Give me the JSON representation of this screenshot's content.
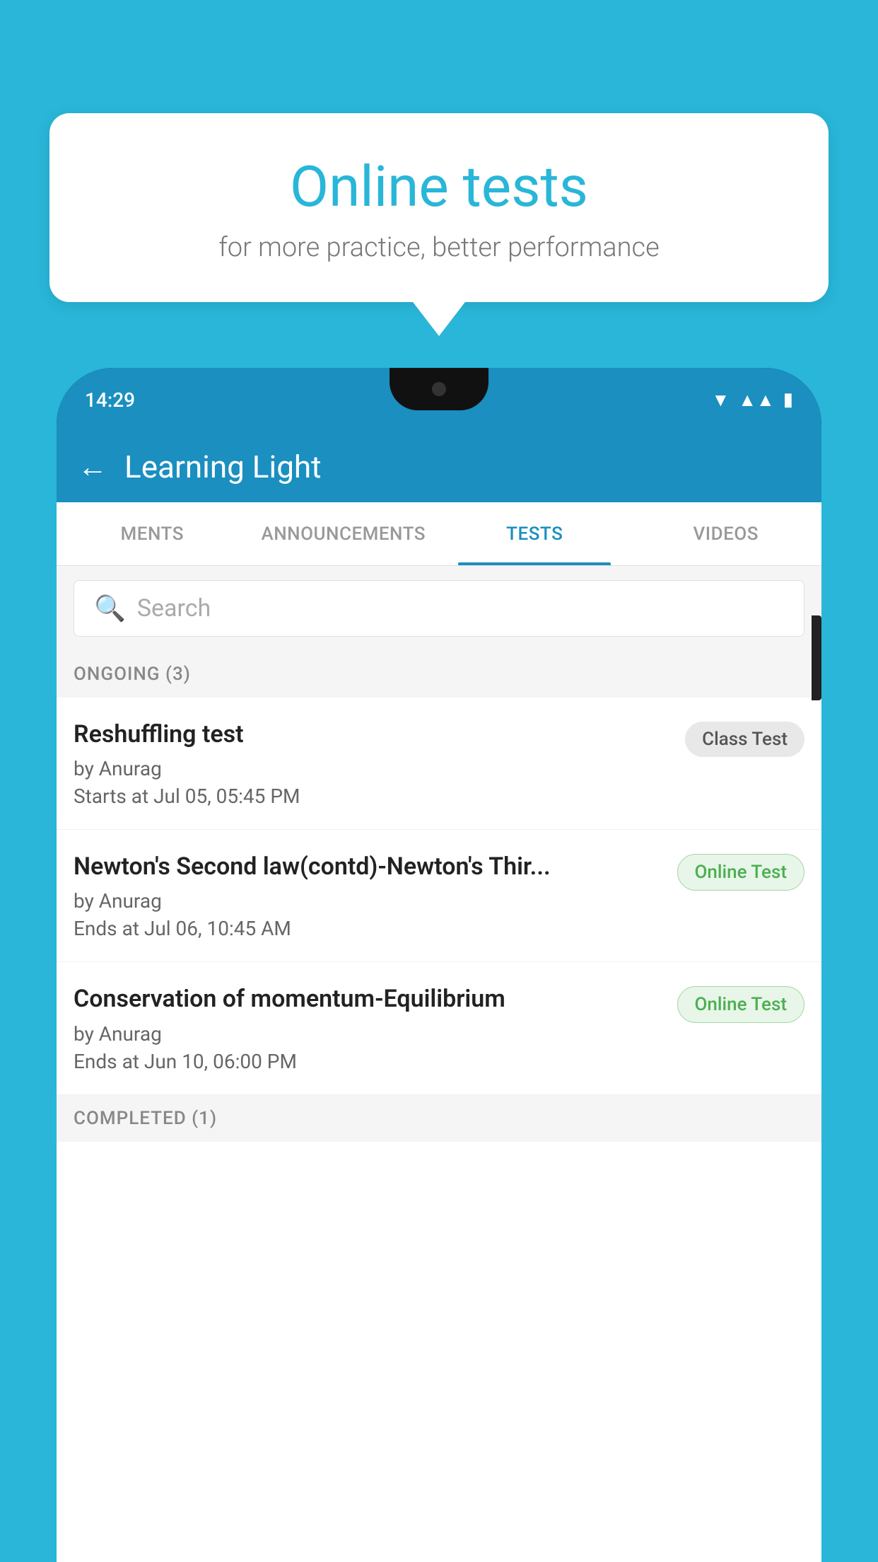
{
  "background_color": "#29b6d8",
  "speech_bubble": {
    "title": "Online tests",
    "subtitle": "for more practice, better performance"
  },
  "phone": {
    "status_bar": {
      "time": "14:29",
      "wifi": "▼",
      "signal": "▲",
      "battery": "▮"
    },
    "app_header": {
      "title": "Learning Light",
      "back_label": "←"
    },
    "tabs": [
      {
        "label": "MENTS",
        "active": false
      },
      {
        "label": "ANNOUNCEMENTS",
        "active": false
      },
      {
        "label": "TESTS",
        "active": true
      },
      {
        "label": "VIDEOS",
        "active": false
      }
    ],
    "search": {
      "placeholder": "Search"
    },
    "ongoing_section": {
      "label": "ONGOING (3)"
    },
    "test_items": [
      {
        "title": "Reshuffling test",
        "author": "by Anurag",
        "date": "Starts at  Jul 05, 05:45 PM",
        "badge": "Class Test",
        "badge_type": "class"
      },
      {
        "title": "Newton's Second law(contd)-Newton's Thir...",
        "author": "by Anurag",
        "date": "Ends at  Jul 06, 10:45 AM",
        "badge": "Online Test",
        "badge_type": "online"
      },
      {
        "title": "Conservation of momentum-Equilibrium",
        "author": "by Anurag",
        "date": "Ends at  Jun 10, 06:00 PM",
        "badge": "Online Test",
        "badge_type": "online"
      }
    ],
    "completed_section": {
      "label": "COMPLETED (1)"
    }
  }
}
